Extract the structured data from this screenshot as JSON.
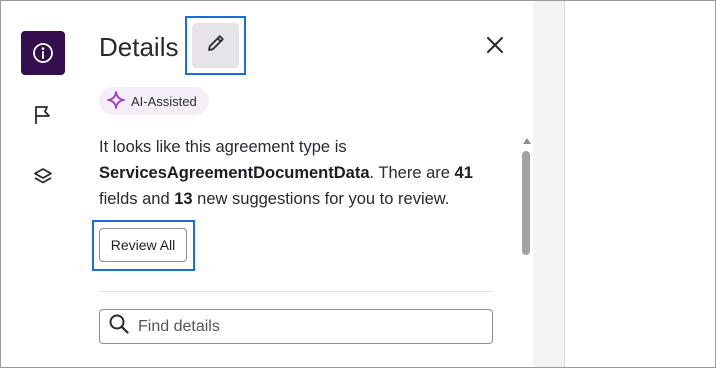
{
  "panel": {
    "title": "Details",
    "badge_label": "AI-Assisted",
    "description": {
      "prefix": "It looks like this agreement type is ",
      "doc_type": "ServicesAgreementDocumentData",
      "mid1": ". There are ",
      "field_count": "41",
      "mid2": " fields and ",
      "suggestion_count": "13",
      "suffix": " new suggestions for you to review."
    },
    "review_button_label": "Review All",
    "search": {
      "placeholder": "Find details",
      "value": ""
    }
  },
  "rail": {
    "items": [
      {
        "name": "info",
        "icon": "info-icon",
        "active": true
      },
      {
        "name": "flag",
        "icon": "flag-icon",
        "active": false
      },
      {
        "name": "layers",
        "icon": "layers-icon",
        "active": false
      }
    ]
  },
  "colors": {
    "rail_active": "#33104d",
    "highlight": "#1a6ed8",
    "badge_bg": "#f4eef8",
    "ai_sparkle": "#a63bc4"
  }
}
